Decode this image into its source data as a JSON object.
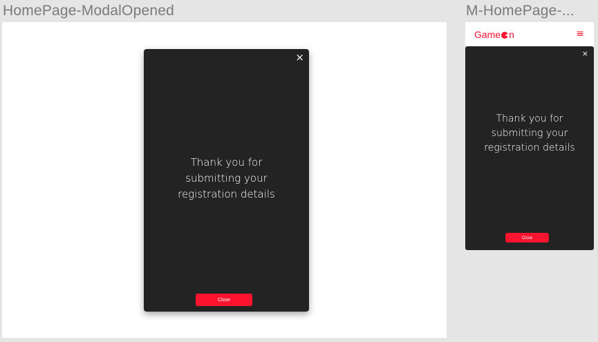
{
  "frames": {
    "desktop": {
      "title": "HomePage-ModalOpened"
    },
    "mobile": {
      "title": "M-HomePage-..."
    }
  },
  "modal": {
    "close_icon": "×",
    "message": "Thank you for submitting your registration details",
    "close_button": "Close"
  },
  "mobile_header": {
    "logo_left": "Game",
    "logo_right": "n",
    "menu_icon": "≡"
  },
  "colors": {
    "accent": "#fe142f",
    "modal_bg": "#232323",
    "canvas_bg": "#e5e5e5"
  }
}
